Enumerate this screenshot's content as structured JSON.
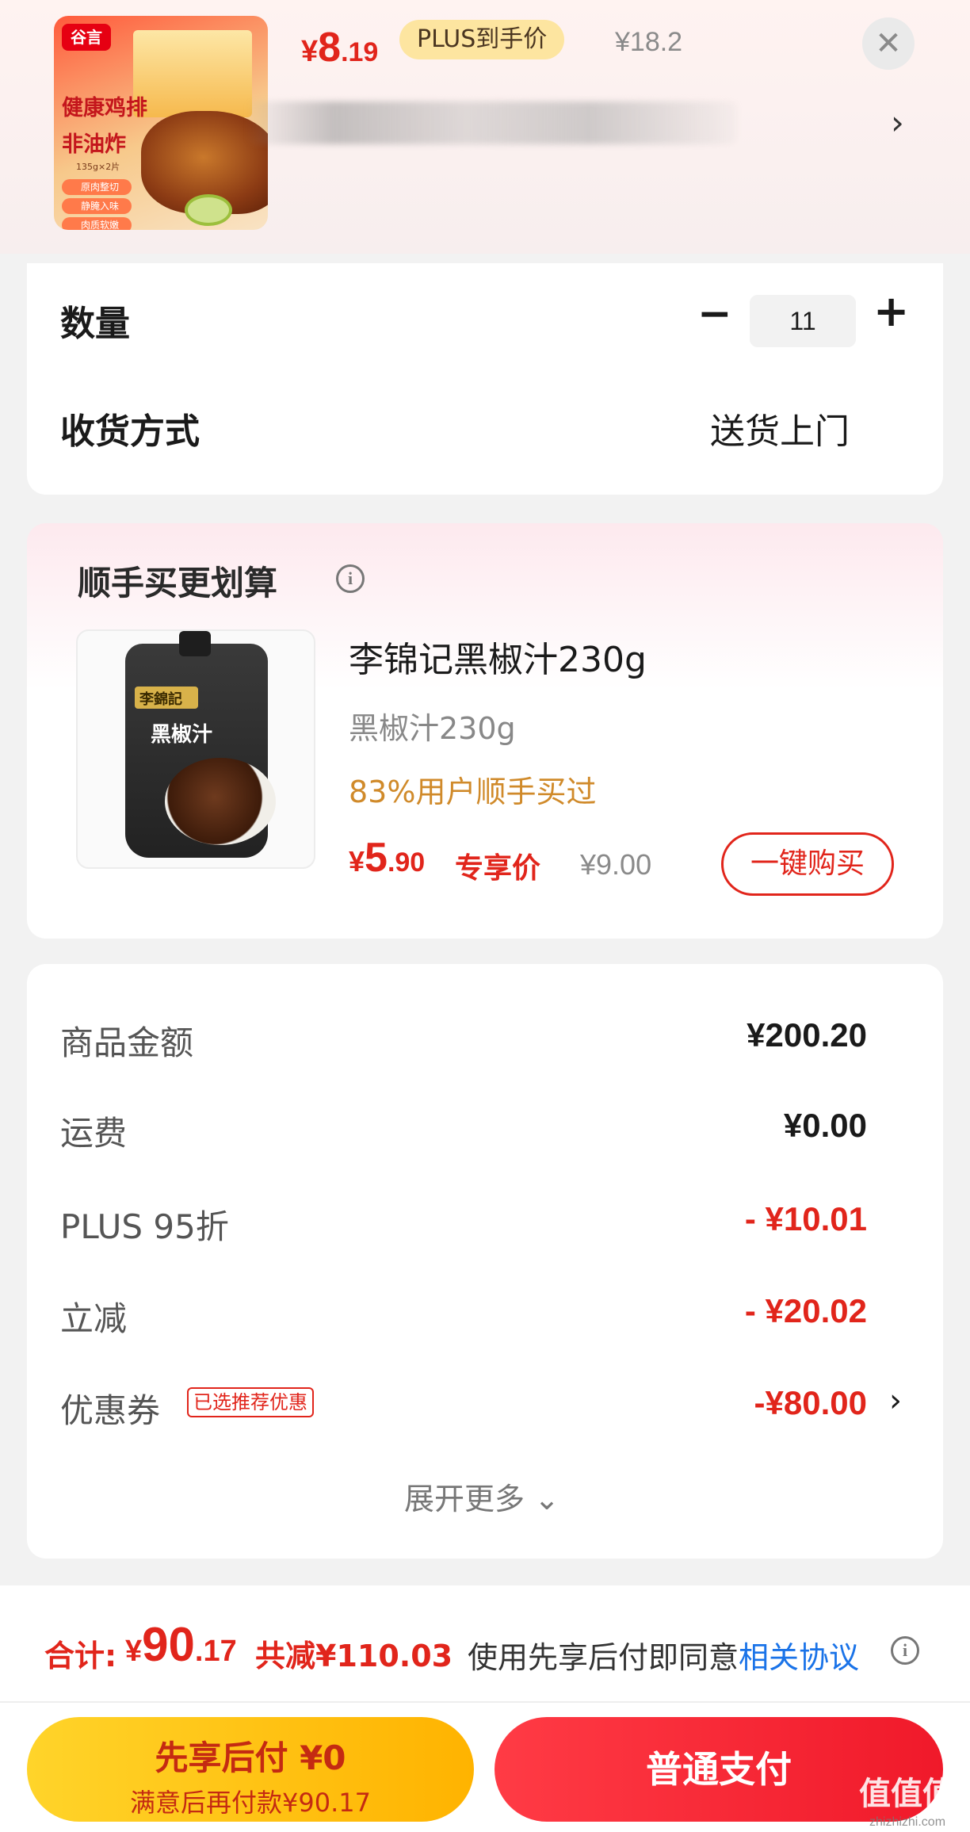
{
  "header": {
    "thumb": {
      "brand_logo": "谷言",
      "tag_line1": "健康鸡排",
      "tag_line2": "非油炸",
      "tag_line3": "135g×2片",
      "pills": [
        "原肉整切",
        "静腌入味",
        "肉质软嫩"
      ]
    },
    "price": {
      "currency": "¥",
      "int": "8",
      "dec": ".19"
    },
    "plus_badge": "PLUS到手价",
    "original_price": "¥18.2",
    "close_icon": "close-icon",
    "title_blurred": true,
    "chevron": "›"
  },
  "order": {
    "quantity_label": "数量",
    "quantity_value": "11",
    "minus": "−",
    "plus": "+",
    "shipping_label": "收货方式",
    "shipping_value": "送货上门"
  },
  "addon": {
    "title": "顺手买更划算",
    "image_brand": "李錦記",
    "image_name": "黑椒汁",
    "name": "李锦记黑椒汁230g",
    "spec": "黑椒汁230g",
    "social_proof": "83%用户顺手买过",
    "price": {
      "currency": "¥",
      "int": "5",
      "dec": ".90"
    },
    "price_label": "专享价",
    "original_price": "¥9.00",
    "buy_button": "一键购买"
  },
  "summary": {
    "rows": [
      {
        "label": "商品金额",
        "value": "¥200.20",
        "red": false
      },
      {
        "label": "运费",
        "value": "¥0.00",
        "red": false
      },
      {
        "label": "PLUS 95折",
        "value": "- ¥10.01",
        "red": true
      },
      {
        "label": "立减",
        "value": "- ¥20.02",
        "red": true
      },
      {
        "label": "优惠券",
        "value": "-¥80.00",
        "red": true
      }
    ],
    "coupon_tag": "已选推荐优惠",
    "expand_more": "展开更多 ⌄"
  },
  "footer": {
    "total_label": "合计:",
    "total": {
      "currency": "¥",
      "int": "90",
      "dec": ".17"
    },
    "saving": "共减¥110.03",
    "agree_text": "使用先享后付即同意",
    "agree_link": "相关协议",
    "pay_later_title": "先享后付 ¥0",
    "pay_later_sub": "满意后再付款¥90.17",
    "pay_normal": "普通支付"
  },
  "watermark": {
    "main": "值值值",
    "sub": "zhizhizhi.com"
  },
  "colors": {
    "accent_red": "#e1251b",
    "plus_gold": "#fde5a0",
    "pay_later_yellow": "#ffc107",
    "link_blue": "#1a73e8"
  }
}
